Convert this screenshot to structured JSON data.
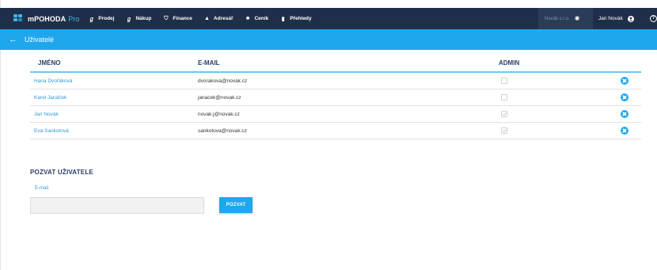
{
  "brand": {
    "name": "mPOHODA",
    "suffix": "Pro"
  },
  "nav": [
    {
      "label": "Prodej",
      "icon": "invoice-out-icon",
      "glyph": "ℊ"
    },
    {
      "label": "Nákup",
      "icon": "invoice-in-icon",
      "glyph": "ℊ"
    },
    {
      "label": "Finance",
      "icon": "finance-icon",
      "glyph": "⛉"
    },
    {
      "label": "Adresář",
      "icon": "person-icon",
      "glyph": "▲"
    },
    {
      "label": "Ceník",
      "icon": "pricelist-icon",
      "glyph": "■"
    },
    {
      "label": "Přehledy",
      "icon": "bar-chart-icon",
      "glyph": "▮"
    }
  ],
  "company": {
    "label": "Novák s.r.o.",
    "icon": "gear-icon",
    "glyph": "✱"
  },
  "user": {
    "label": "Jan Novák",
    "icon": "user-circle-icon"
  },
  "help": {
    "glyph": "?",
    "icon": "help-icon"
  },
  "page": {
    "back_glyph": "←",
    "title": "Uživatelé"
  },
  "table": {
    "headers": {
      "name": "JMÉNO",
      "email": "E-MAIL",
      "admin": "ADMIN"
    },
    "rows": [
      {
        "name": "Hana Dvořáková",
        "email": "dvorakova@novak.cz",
        "admin": false
      },
      {
        "name": "Karel Janáček",
        "email": "janacek@novak.cz",
        "admin": false
      },
      {
        "name": "Jan Novák",
        "email": "novak.j@novak.cz",
        "admin": true
      },
      {
        "name": "Eva Sankotová",
        "email": "sankotova@novak.cz",
        "admin": true
      }
    ]
  },
  "invite": {
    "title": "POZVAT UŽIVATELE",
    "email_label": "E-mail",
    "email_value": "",
    "button_label": "POZVAT"
  },
  "colors": {
    "topbar": "#1f2f4a",
    "subbar": "#1ea7ec",
    "accent": "#1ea7ec",
    "link": "#2a9ad8",
    "header_text": "#2a3d66"
  }
}
